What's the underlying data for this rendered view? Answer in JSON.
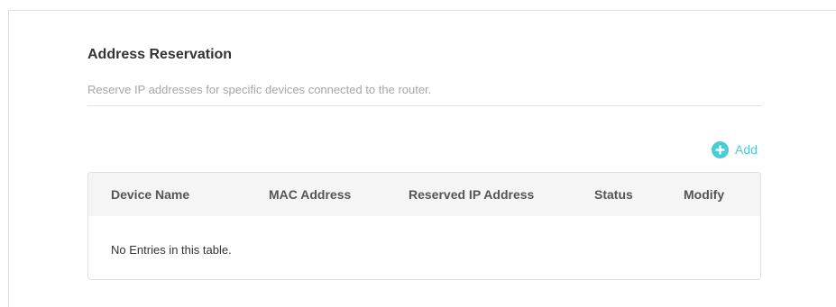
{
  "section": {
    "title": "Address Reservation",
    "description": "Reserve IP addresses for specific devices connected to the router."
  },
  "toolbar": {
    "add_label": "Add",
    "add_icon": "plus-circle-icon"
  },
  "table": {
    "columns": [
      "Device Name",
      "MAC Address",
      "Reserved IP Address",
      "Status",
      "Modify"
    ],
    "rows": [],
    "empty_message": "No Entries in this table."
  },
  "colors": {
    "accent": "#4acbd6",
    "title_text": "#333333",
    "muted_text": "#a6a6a6",
    "header_bg": "#f5f5f5"
  }
}
